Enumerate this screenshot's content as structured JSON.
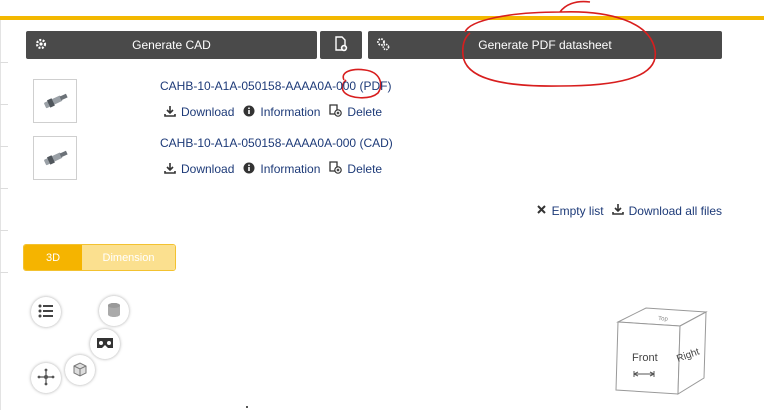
{
  "toolbar": {
    "generate_cad_label": "Generate CAD",
    "generate_pdf_label": "Generate PDF datasheet",
    "icons": [
      "gear-icon",
      "document-add-icon",
      "gears-icon"
    ]
  },
  "results": [
    {
      "title": "CAHB-10-A1A-050158-AAAA0A-000 (PDF)",
      "actions": {
        "download": "Download",
        "information": "Information",
        "delete": "Delete"
      }
    },
    {
      "title": "CAHB-10-A1A-050158-AAAA0A-000 (CAD)",
      "actions": {
        "download": "Download",
        "information": "Information",
        "delete": "Delete"
      }
    }
  ],
  "list_actions": {
    "empty": "Empty list",
    "download_all": "Download all files"
  },
  "view_tabs": {
    "tab_3d": "3D",
    "tab_dimension": "Dimension"
  },
  "view_controls": [
    "list-icon",
    "database-icon",
    "vr-goggles-icon",
    "cube-icon",
    "move-axes-icon"
  ],
  "viewcube": {
    "front": "Front",
    "right": "Right",
    "top": "Top"
  },
  "colors": {
    "accent": "#f3b800",
    "button_dark": "#4a4a4a",
    "link": "#1d3a78",
    "tab_inactive": "#fbe08f"
  }
}
